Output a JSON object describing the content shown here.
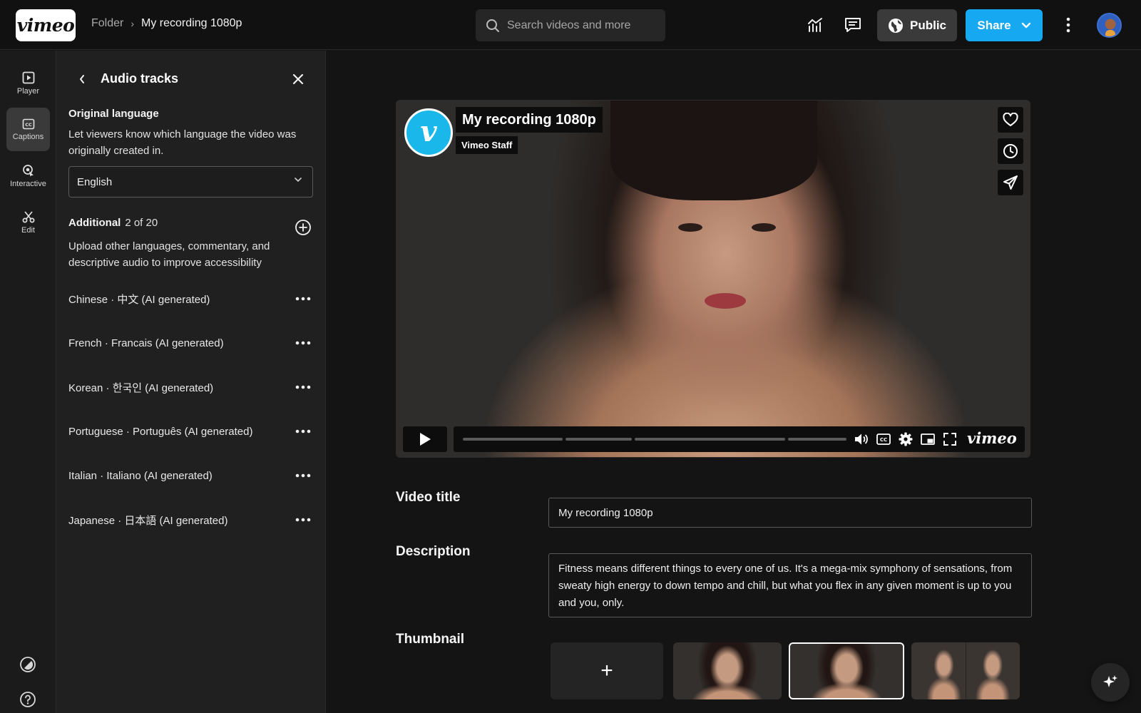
{
  "app": {
    "logo_text": "vimeo"
  },
  "breadcrumb": {
    "folder": "Folder",
    "separator": "›",
    "current": "My recording 1080p"
  },
  "search": {
    "placeholder": "Search videos and more"
  },
  "header": {
    "icons": [
      "analytics-icon",
      "comments-icon",
      "more-vertical-icon"
    ],
    "public_label": "Public",
    "share_label": "Share"
  },
  "rail": {
    "items": [
      {
        "label": "Player",
        "icon": "player-icon"
      },
      {
        "label": "Captions",
        "icon": "captions-icon",
        "active": true
      },
      {
        "label": "Interactive",
        "icon": "interactive-icon"
      },
      {
        "label": "Edit",
        "icon": "scissors-icon"
      }
    ],
    "bottom_icons": [
      "appearance-icon",
      "help-icon"
    ]
  },
  "panel": {
    "title": "Audio tracks",
    "original": {
      "title": "Original language",
      "description": "Let viewers know which language the video was originally created in.",
      "selected": "English"
    },
    "additional": {
      "title": "Additional",
      "count": "2 of 20",
      "description": "Upload other languages, commentary, and descriptive audio to improve accessibility"
    },
    "tracks": [
      "Chinese · 中文 (AI generated)",
      "French · Francais (AI generated)",
      "Korean · 한국인 (AI generated)",
      "Portuguese · Português (AI generated)",
      "Italian · Italiano (AI generated)",
      "Japanese · 日本語 (AI generated)"
    ]
  },
  "player": {
    "badge_letter": "v",
    "title": "My recording 1080p",
    "owner": "Vimeo Staff",
    "logo_text": "vimeo"
  },
  "form": {
    "title_label": "Video title",
    "title_value": "My recording 1080p",
    "description_label": "Description",
    "description_value": "Fitness means different things to every one of us. It's a mega-mix symphony of sensations, from sweaty high energy to down tempo and chill, but what you flex in any given moment is up to you and you, only.",
    "thumbnail_label": "Thumbnail",
    "thumbnail_add": "+"
  },
  "colors": {
    "accent": "#17a8f2",
    "badge": "#19b7ea"
  }
}
